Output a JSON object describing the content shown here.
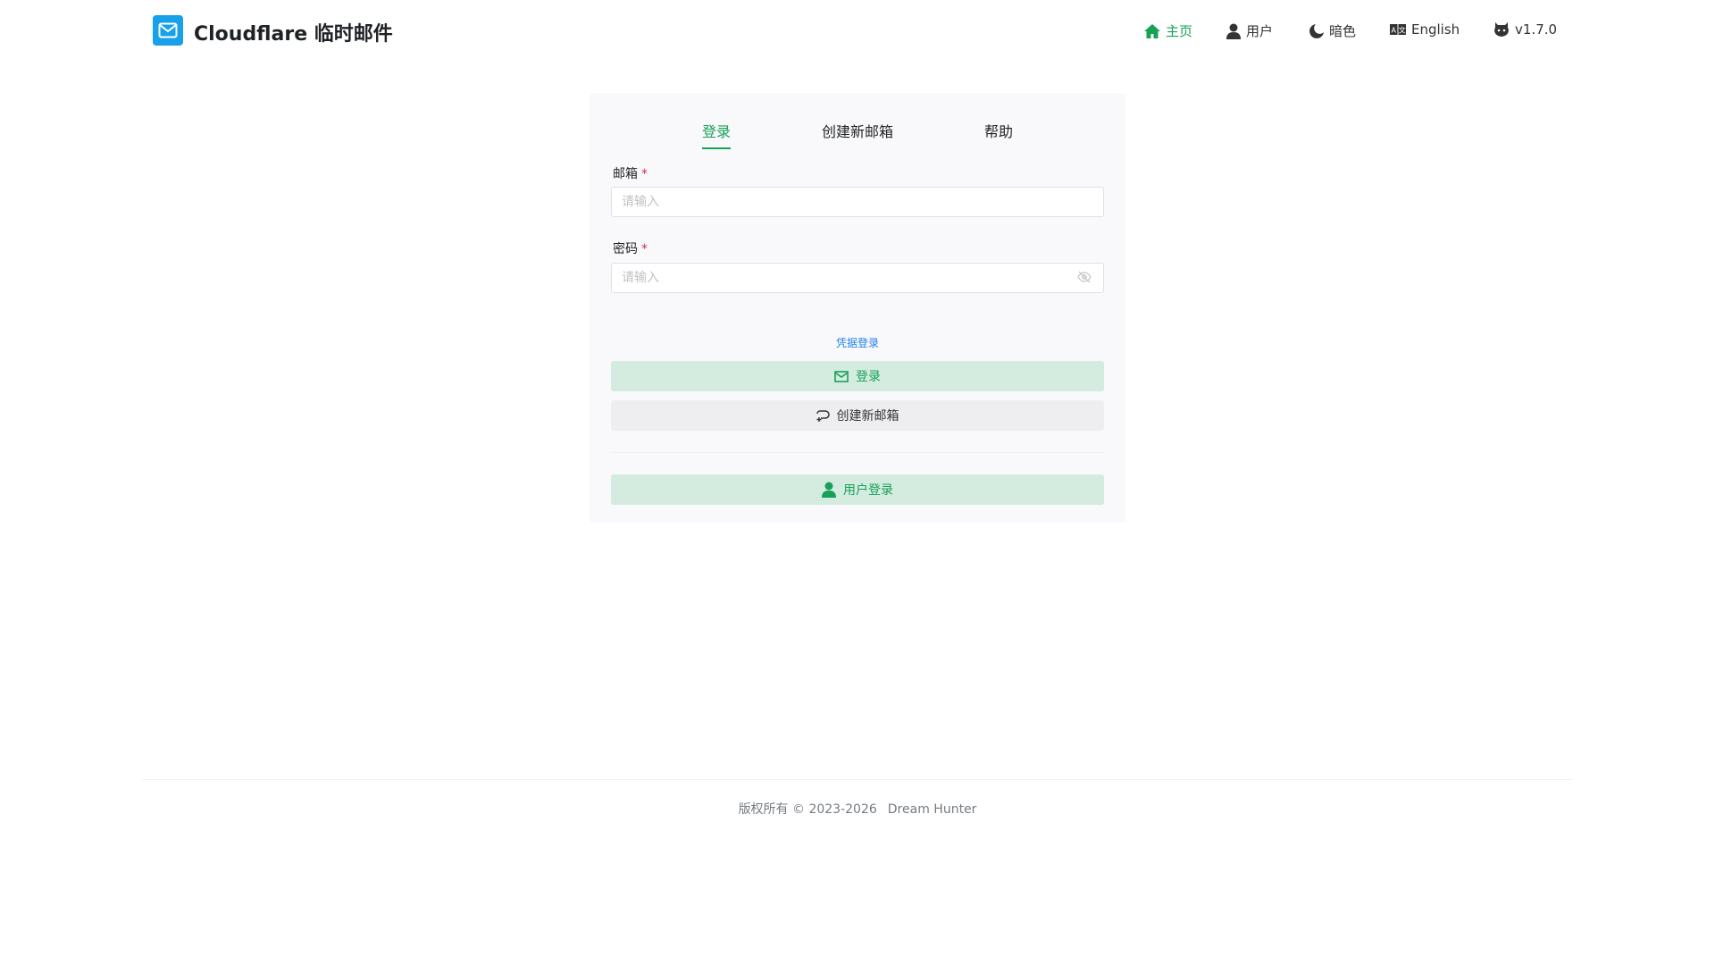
{
  "header": {
    "title": "Cloudflare 临时邮件",
    "nav": [
      {
        "label": "主页",
        "icon": "home-icon"
      },
      {
        "label": "用户",
        "icon": "user-icon"
      },
      {
        "label": "暗色",
        "icon": "moon-icon"
      },
      {
        "label": "English",
        "icon": "translate-icon"
      },
      {
        "label": "v1.7.0",
        "icon": "github-icon"
      }
    ]
  },
  "tabs": [
    "登录",
    "创建新邮箱",
    "帮助"
  ],
  "form": {
    "email_label": "邮箱",
    "password_label": "密码",
    "required": "*",
    "email_placeholder": "请输入",
    "password_placeholder": "请输入",
    "credential_link": "凭据登录",
    "login_button": "登录",
    "create_button": "创建新邮箱",
    "user_login_button": "用户登录"
  },
  "footer": {
    "copyright": "版权所有 © 2023-2026",
    "author": "Dream Hunter"
  },
  "colors": {
    "accent": "#18a058",
    "logo": "#18a0e8",
    "link": "#2080f0"
  }
}
